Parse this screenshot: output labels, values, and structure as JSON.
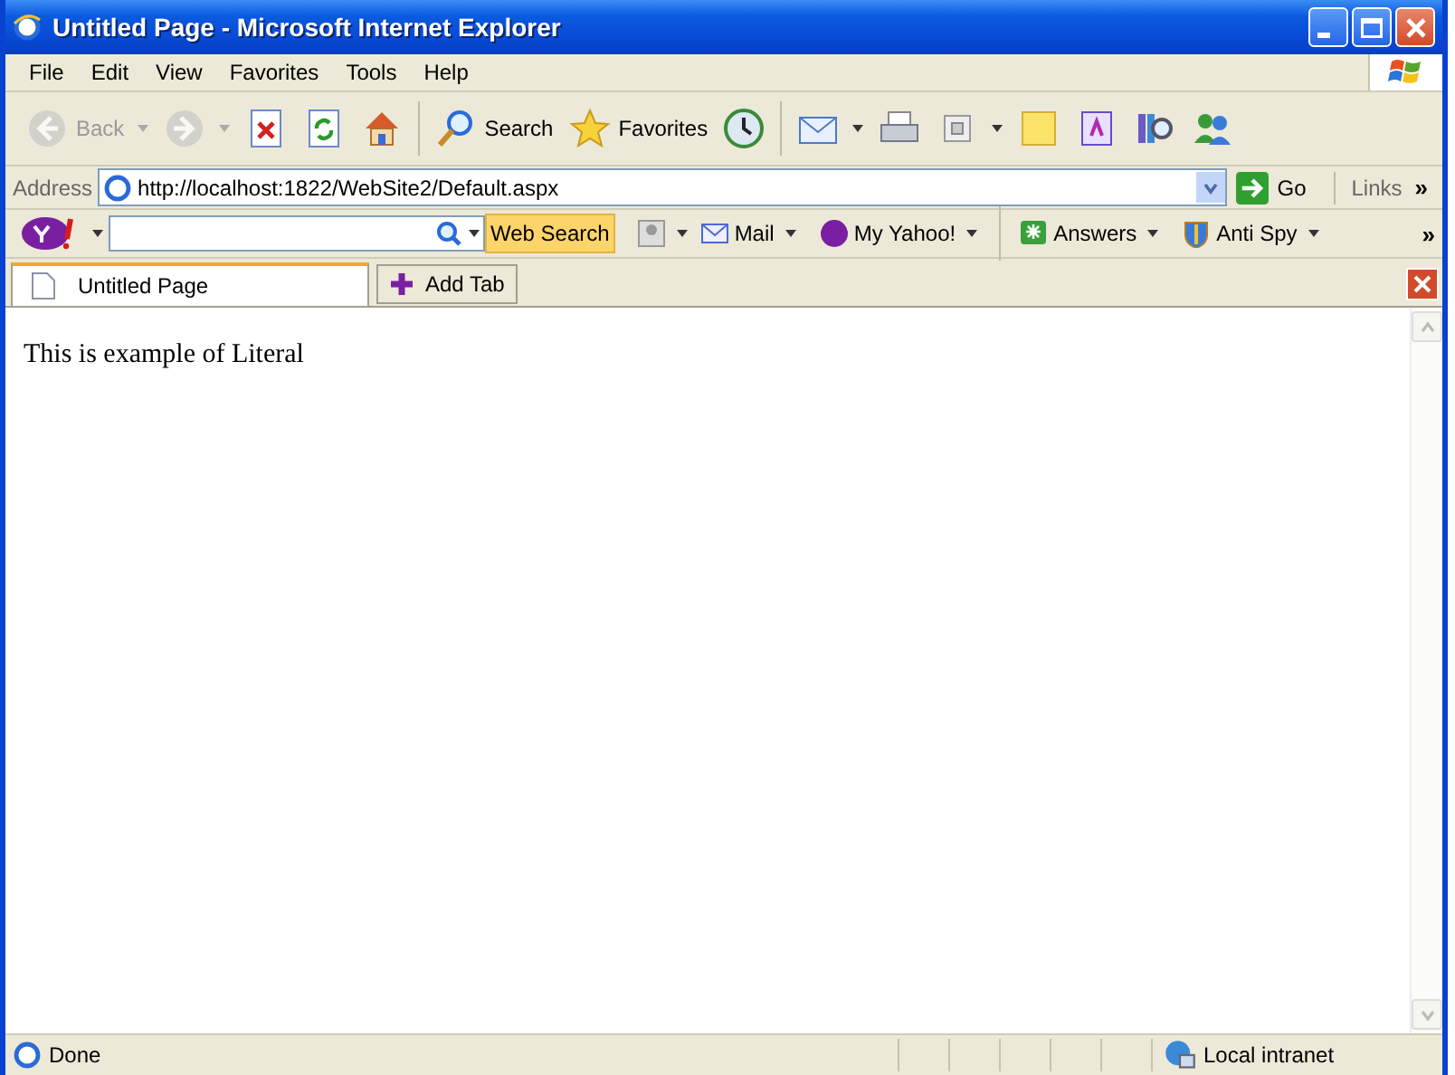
{
  "window": {
    "title": "Untitled Page - Microsoft Internet Explorer"
  },
  "menu": [
    "File",
    "Edit",
    "View",
    "Favorites",
    "Tools",
    "Help"
  ],
  "toolbar": [
    {
      "kind": "back",
      "label": "Back",
      "disabled": true,
      "dropdown": true
    },
    {
      "kind": "forward",
      "disabled": true,
      "dropdown": true
    },
    {
      "kind": "stop",
      "disabled": false,
      "dropdown": false
    },
    {
      "kind": "refresh",
      "disabled": false,
      "dropdown": false
    },
    {
      "kind": "home",
      "disabled": false,
      "dropdown": false
    },
    {
      "kind": "search",
      "label": "Search",
      "disabled": false,
      "dropdown": false
    },
    {
      "kind": "favorites",
      "label": "Favorites",
      "disabled": false,
      "dropdown": false
    },
    {
      "kind": "history",
      "disabled": false,
      "dropdown": false
    },
    {
      "kind": "mail",
      "disabled": false,
      "dropdown": true
    },
    {
      "kind": "print",
      "disabled": false,
      "dropdown": false
    },
    {
      "kind": "edit",
      "disabled": false,
      "dropdown": true
    },
    {
      "kind": "note",
      "disabled": false,
      "dropdown": false
    },
    {
      "kind": "messenger",
      "disabled": false,
      "dropdown": false
    },
    {
      "kind": "research",
      "disabled": false,
      "dropdown": false
    },
    {
      "kind": "people",
      "disabled": false,
      "dropdown": false
    }
  ],
  "address": {
    "label": "Address",
    "value": "http://localhost:1822/WebSite2/Default.aspx",
    "go": "Go",
    "links": "Links",
    "more": "»"
  },
  "yahoo_bar": {
    "search_button": "Web Search",
    "items": [
      {
        "kind": "mail",
        "label": "Mail"
      },
      {
        "kind": "myyahoo",
        "label": "My Yahoo!"
      },
      {
        "kind": "answers",
        "label": "Answers"
      },
      {
        "kind": "antispy",
        "label": "Anti Spy"
      }
    ],
    "more": "»"
  },
  "tabs": [
    {
      "label": "Untitled Page",
      "selected": true
    }
  ],
  "add_tab": "Add Tab",
  "page": {
    "text": "This is example of Literal"
  },
  "status_bar": {
    "text": "Done",
    "zone": "Local intranet"
  }
}
